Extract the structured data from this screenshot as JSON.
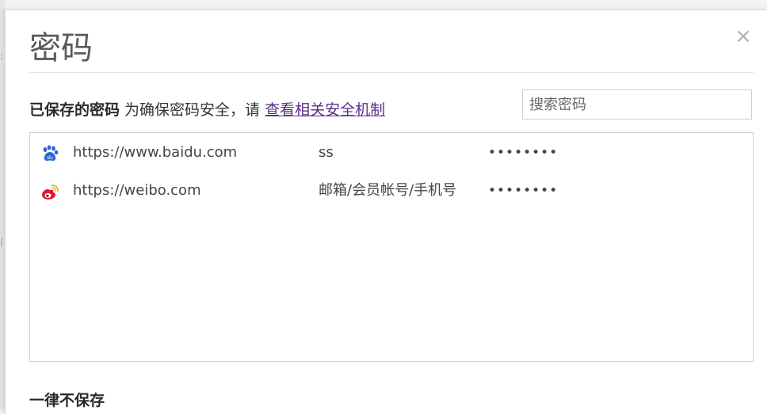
{
  "dialog": {
    "title": "密码",
    "close_icon": "close-icon"
  },
  "saved": {
    "heading": "已保存的密码",
    "note": " 为确保密码安全，请 ",
    "link": "查看相关安全机制"
  },
  "search": {
    "placeholder": "搜索密码",
    "value": ""
  },
  "passwords": [
    {
      "site": "https://www.baidu.com",
      "username": "ss",
      "password": "••••••••",
      "icon": "baidu-paw-icon"
    },
    {
      "site": "https://weibo.com",
      "username": "邮箱/会员帐号/手机号",
      "password": "••••••••",
      "icon": "weibo-icon"
    }
  ],
  "never_save": {
    "heading": "一律不保存"
  },
  "colors": {
    "link": "#5b2f8a",
    "baidu_blue": "#2b63d9",
    "weibo_red": "#e6162d",
    "weibo_orange": "#f5a623"
  }
}
